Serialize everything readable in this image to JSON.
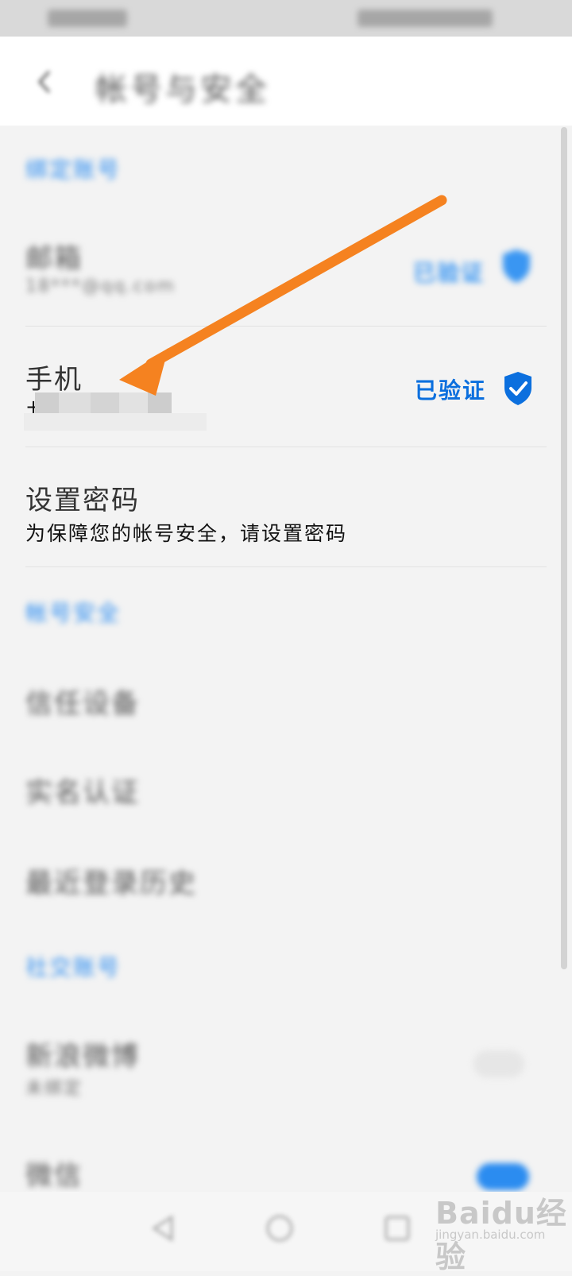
{
  "app_bar": {
    "title": "帐号与安全"
  },
  "sections": {
    "bound_accounts": "绑定账号",
    "account_security": "帐号安全",
    "social_accounts": "社交账号"
  },
  "email": {
    "title": "邮箱",
    "value": "18***@qq.com",
    "status": "已验证"
  },
  "phone": {
    "title": "手机",
    "value_prefix": "+",
    "status": "已验证"
  },
  "password": {
    "title": "设置密码",
    "subtitle": "为保障您的帐号安全，请设置密码"
  },
  "security_items": [
    "信任设备",
    "实名认证",
    "最近登录历史"
  ],
  "weibo": {
    "title": "新浪微博",
    "subtitle": "未绑定"
  },
  "wechat": {
    "title": "微信"
  },
  "watermark": {
    "brand": "Baidu经验",
    "url": "jingyan.baidu.com"
  },
  "colors": {
    "accent": "#0b6fde",
    "annotation_arrow": "#f58220"
  },
  "icons": [
    "back-icon",
    "shield-check-icon",
    "nav-back-icon",
    "nav-home-icon",
    "nav-recents-icon"
  ]
}
